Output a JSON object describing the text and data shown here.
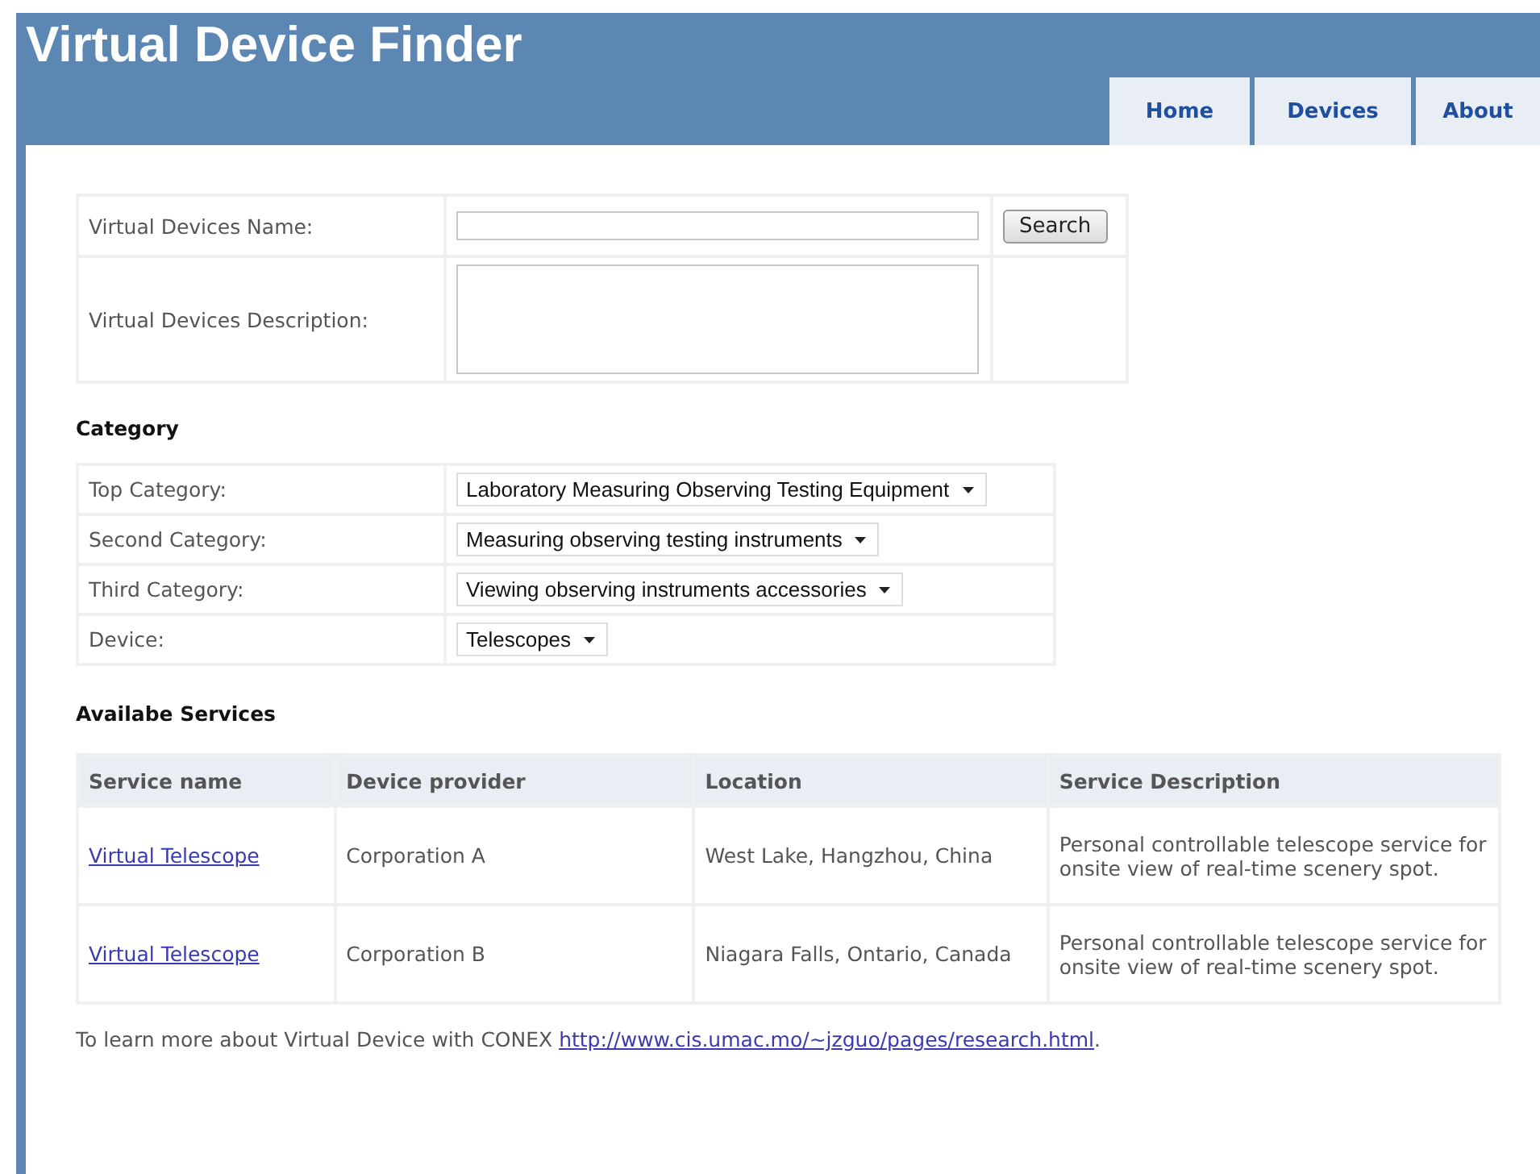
{
  "header": {
    "title": "Virtual Device Finder"
  },
  "tabs": [
    {
      "label": "Home",
      "selected": false
    },
    {
      "label": "Devices",
      "selected": false
    },
    {
      "label": "About",
      "selected": false
    }
  ],
  "search_form": {
    "name_label": "Virtual Devices Name:",
    "description_label": "Virtual Devices Description:",
    "search_button": "Search"
  },
  "category": {
    "heading": "Category",
    "rows": [
      {
        "label": "Top Category:",
        "value": "Laboratory Measuring Observing Testing Equipment"
      },
      {
        "label": "Second Category:",
        "value": "Measuring observing testing instruments"
      },
      {
        "label": "Third Category:",
        "value": "Viewing observing instruments accessories"
      },
      {
        "label": "Device:",
        "value": "Telescopes"
      }
    ]
  },
  "services": {
    "heading": "Availabe Services",
    "columns": [
      "Service name",
      "Device provider",
      "Location",
      "Service Description"
    ],
    "rows": [
      {
        "service_name": "Virtual Telescope",
        "device_provider": "Corporation A",
        "location": "West Lake, Hangzhou, China",
        "service_description": "Personal controllable telescope service for onsite view of real-time scenery spot."
      },
      {
        "service_name": "Virtual Telescope",
        "device_provider": "Corporation B",
        "location": "Niagara Falls, Ontario, Canada",
        "service_description": "Personal controllable telescope service for onsite view of real-time scenery spot."
      }
    ]
  },
  "footer": {
    "text": "To learn more about Virtual Device with CONEX",
    "link": "http://www.cis.umac.mo/~jzguo/pages/research.html",
    "trailing": "."
  }
}
